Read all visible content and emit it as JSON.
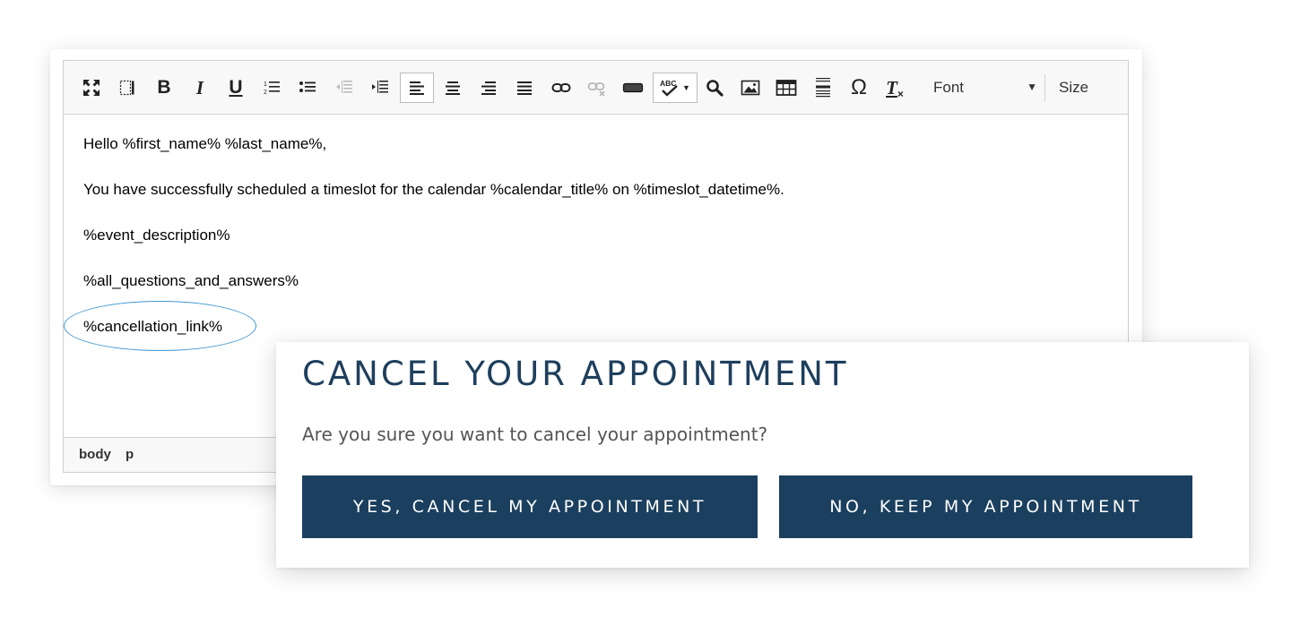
{
  "editor": {
    "toolbar": {
      "buttons": [
        {
          "name": "maximize-icon"
        },
        {
          "name": "show-blocks-icon"
        },
        {
          "name": "bold-icon",
          "label": "B"
        },
        {
          "name": "italic-icon",
          "label": "I"
        },
        {
          "name": "underline-icon",
          "label": "U"
        },
        {
          "name": "numbered-list-icon"
        },
        {
          "name": "bulleted-list-icon"
        },
        {
          "name": "decrease-indent-icon"
        },
        {
          "name": "increase-indent-icon"
        },
        {
          "name": "align-left-icon"
        },
        {
          "name": "align-center-icon"
        },
        {
          "name": "align-right-icon"
        },
        {
          "name": "justify-icon"
        },
        {
          "name": "link-icon"
        },
        {
          "name": "unlink-icon"
        },
        {
          "name": "text-field-icon"
        },
        {
          "name": "spellcheck-icon",
          "label": "ABC"
        },
        {
          "name": "find-icon"
        },
        {
          "name": "image-icon"
        },
        {
          "name": "table-icon"
        },
        {
          "name": "horizontal-rule-icon"
        },
        {
          "name": "special-character-icon",
          "label": "Ω"
        },
        {
          "name": "remove-format-icon",
          "label": "T"
        }
      ],
      "font_label": "Font",
      "size_label": "Size"
    },
    "content": [
      "Hello %first_name% %last_name%,",
      "You have successfully scheduled a timeslot for the calendar %calendar_title% on %timeslot_datetime%.",
      "%event_description%",
      "%all_questions_and_answers%",
      "%cancellation_link%"
    ],
    "statusbar": [
      "body",
      "p"
    ],
    "colors": {
      "highlight": "#3d95cf",
      "toolbar_bg": "#f8f8f8"
    }
  },
  "dialog": {
    "title": "CANCEL YOUR APPOINTMENT",
    "text": "Are you sure you want to cancel your appointment?",
    "yes_label": "YES, CANCEL MY APPOINTMENT",
    "no_label": "NO, KEEP MY APPOINTMENT",
    "colors": {
      "title": "#1e3f5d",
      "button_bg": "#1b3f5e",
      "button_text": "#ffffff"
    }
  }
}
